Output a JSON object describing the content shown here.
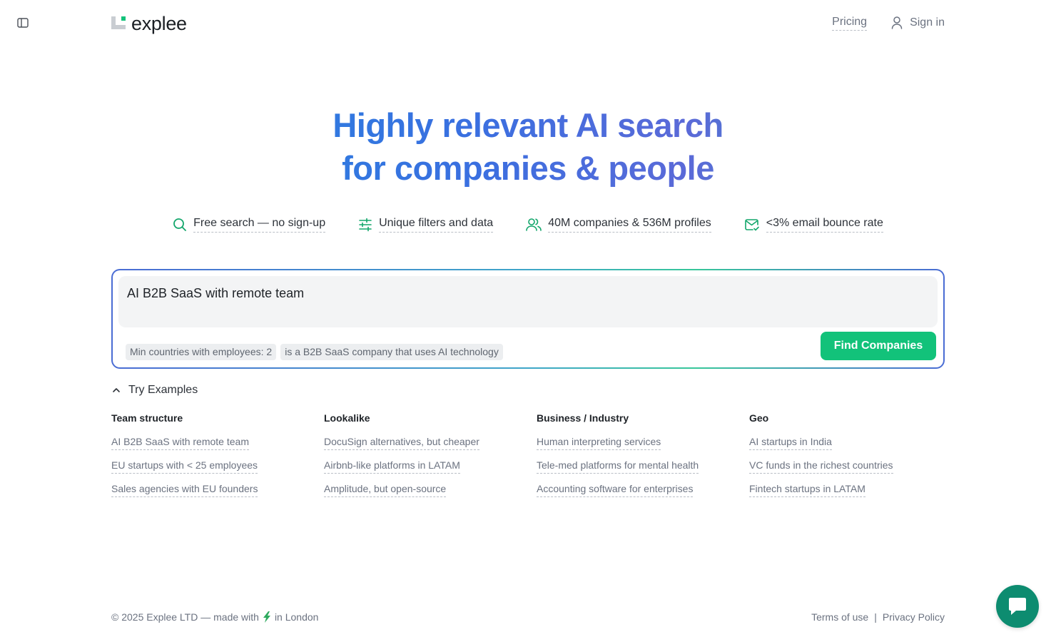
{
  "header": {
    "logo_text": "explee",
    "nav": {
      "pricing": "Pricing",
      "sign_in": "Sign in"
    }
  },
  "hero": {
    "line1": "Highly relevant AI search",
    "line2": "for companies & people"
  },
  "features": [
    {
      "icon": "search-icon",
      "label": "Free search — no sign-up"
    },
    {
      "icon": "sliders-icon",
      "label": "Unique filters and data"
    },
    {
      "icon": "users-icon",
      "label": "40M companies & 536M profiles"
    },
    {
      "icon": "mail-check-icon",
      "label": "<3% email bounce rate"
    }
  ],
  "search": {
    "query": "AI B2B SaaS with remote team",
    "chips": [
      "Min countries with employees: 2",
      "is a B2B SaaS company that uses AI technology"
    ],
    "button_label": "Find Companies"
  },
  "examples": {
    "toggle_label": "Try Examples",
    "columns": [
      {
        "heading": "Team structure",
        "items": [
          "AI B2B SaaS with remote team",
          "EU startups with < 25 employees",
          "Sales agencies with EU founders"
        ]
      },
      {
        "heading": "Lookalike",
        "items": [
          "DocuSign alternatives, but cheaper",
          "Airbnb-like platforms in LATAM",
          "Amplitude, but open-source"
        ]
      },
      {
        "heading": "Business / Industry",
        "items": [
          "Human interpreting services",
          "Tele-med platforms for mental health",
          "Accounting software for enterprises"
        ]
      },
      {
        "heading": "Geo",
        "items": [
          "AI startups in India",
          "VC funds in the richest countries",
          "Fintech startups in LATAM"
        ]
      }
    ]
  },
  "footer": {
    "copyright_prefix": "© 2025 Explee LTD — made with",
    "copyright_suffix": "in London",
    "terms": "Terms of use",
    "separator": "|",
    "privacy": "Privacy Policy"
  },
  "colors": {
    "accent_green": "#12c27a",
    "gradient_blue": "#3a6fe0",
    "chat_bubble": "#0d8c70"
  }
}
